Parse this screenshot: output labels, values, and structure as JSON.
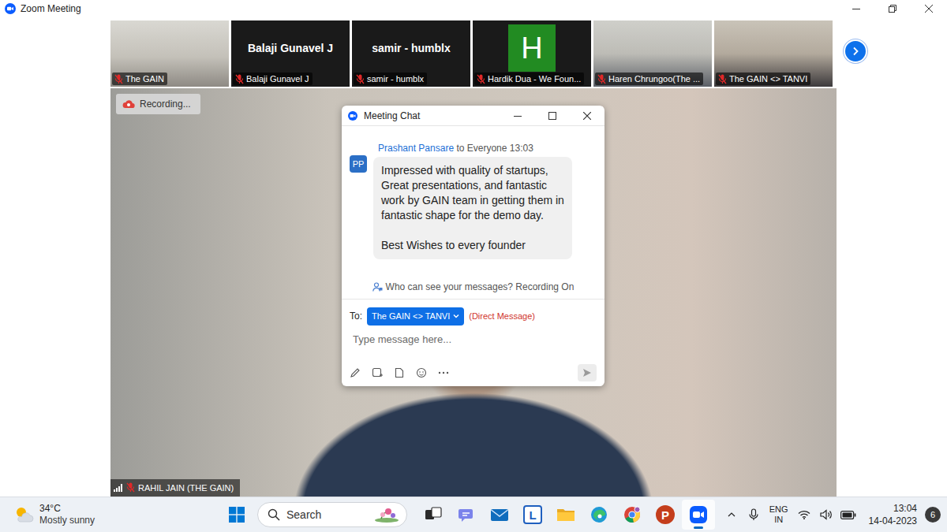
{
  "window": {
    "title": "Zoom Meeting"
  },
  "gallery": {
    "tiles": [
      {
        "kind": "video",
        "label": "The GAIN",
        "muted": true
      },
      {
        "kind": "name",
        "title": "Balaji Gunavel J",
        "label": "Balaji Gunavel J",
        "muted": true
      },
      {
        "kind": "name",
        "title": "samir - humblx",
        "label": "samir - humblx",
        "muted": true
      },
      {
        "kind": "avatar",
        "initial": "H",
        "color": "#228b22",
        "label": "Hardik Dua - We Foun...",
        "muted": true
      },
      {
        "kind": "video",
        "label": "Haren Chrungoo(The ...",
        "muted": true
      },
      {
        "kind": "video",
        "label": "The GAIN <> TANVI",
        "muted": true
      }
    ]
  },
  "recording": {
    "label": "Recording..."
  },
  "speaker": {
    "name": "RAHIL JAIN (THE GAIN)",
    "muted": true
  },
  "chat": {
    "title": "Meeting Chat",
    "messages": [
      {
        "initials": "PP",
        "sender": "Prashant Pansare",
        "to": "to",
        "recipient": "Everyone",
        "time": "13:03",
        "text": "Impressed with quality of startups, Great presentations, and fantastic work by GAIN team in getting them in fantastic shape for the demo day.\n\nBest Wishes to every founder"
      }
    ],
    "notice": "Who can see your messages? Recording On",
    "to_label": "To:",
    "recipient": "The GAIN <> TANVI",
    "recipient_note": "(Direct Message)",
    "placeholder": "Type message here..."
  },
  "taskbar": {
    "weather": {
      "temp": "34°C",
      "condition": "Mostly sunny"
    },
    "search": "Search",
    "apps": [
      {
        "kind": "taskview",
        "selected": false
      },
      {
        "kind": "chat",
        "selected": false
      },
      {
        "kind": "mail",
        "selected": false
      },
      {
        "kind": "launcher",
        "letter": "L",
        "selected": false
      },
      {
        "kind": "explorer",
        "selected": false
      },
      {
        "kind": "edge",
        "selected": false
      },
      {
        "kind": "chrome",
        "selected": false
      },
      {
        "kind": "powerpoint",
        "letter": "P",
        "selected": false
      },
      {
        "kind": "zoom",
        "selected": true
      }
    ],
    "language": "ENG",
    "region": "IN",
    "time": "13:04",
    "date": "14-04-2023",
    "notifications": "6"
  }
}
